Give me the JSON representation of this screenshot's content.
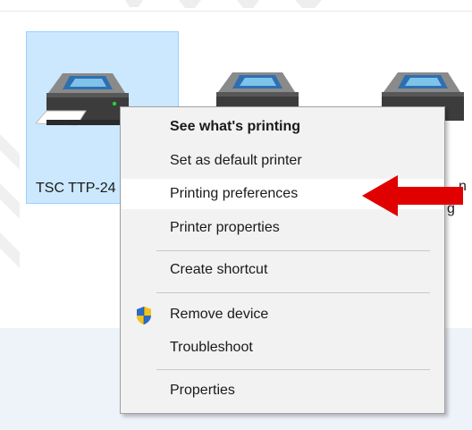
{
  "devices": [
    {
      "label": "TSC TTP-24",
      "selected": true
    },
    {
      "label": "",
      "selected": false
    },
    {
      "label_fragment_1": "n",
      "label_fragment_2": "g",
      "selected": false
    }
  ],
  "context_menu": {
    "items": [
      {
        "label": "See what's printing",
        "bold": true
      },
      {
        "label": "Set as default printer"
      },
      {
        "label": "Printing preferences",
        "highlighted": true
      },
      {
        "label": "Printer properties"
      },
      {
        "label": "Create shortcut"
      },
      {
        "label": "Remove device",
        "icon": "uac-shield-icon"
      },
      {
        "label": "Troubleshoot"
      },
      {
        "label": "Properties"
      }
    ]
  },
  "annotation": {
    "icon": "red-arrow-left",
    "color": "#e00000"
  },
  "colors": {
    "selection_fill": "#cce8ff",
    "selection_border": "#99d1ff",
    "menu_bg": "#f2f2f2",
    "panel_bg": "#eef3fa"
  }
}
